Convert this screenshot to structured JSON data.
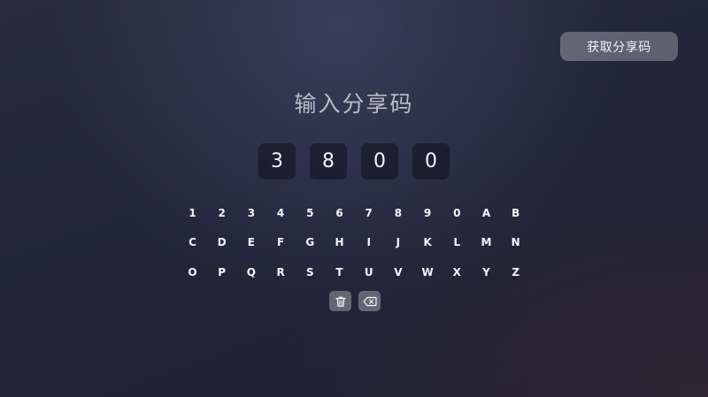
{
  "header": {
    "get_code_label": "获取分享码"
  },
  "main": {
    "title": "输入分享码",
    "code_digits": [
      "3",
      "8",
      "0",
      "0"
    ],
    "keyboard_rows": [
      [
        "1",
        "2",
        "3",
        "4",
        "5",
        "6",
        "7",
        "8",
        "9",
        "0",
        "A",
        "B"
      ],
      [
        "C",
        "D",
        "E",
        "F",
        "G",
        "H",
        "I",
        "J",
        "K",
        "L",
        "M",
        "N"
      ],
      [
        "O",
        "P",
        "Q",
        "R",
        "S",
        "T",
        "U",
        "V",
        "W",
        "X",
        "Y",
        "Z"
      ]
    ],
    "action_keys": [
      {
        "icon": "trash-icon"
      },
      {
        "icon": "backspace-icon"
      }
    ]
  }
}
